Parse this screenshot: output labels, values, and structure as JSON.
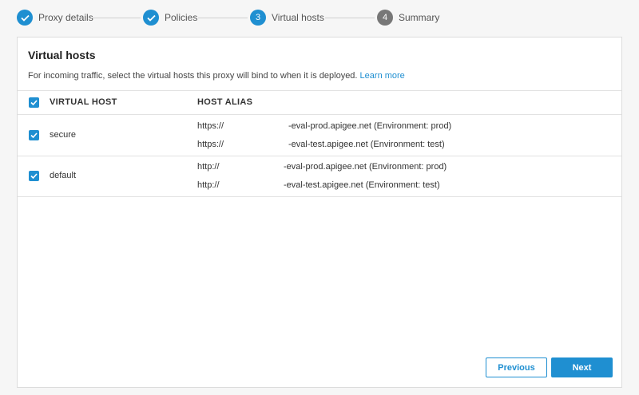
{
  "stepper": {
    "steps": [
      {
        "number": "",
        "label": "Proxy details",
        "state": "done"
      },
      {
        "number": "",
        "label": "Policies",
        "state": "done"
      },
      {
        "number": "3",
        "label": "Virtual hosts",
        "state": "active"
      },
      {
        "number": "4",
        "label": "Summary",
        "state": "pending"
      }
    ]
  },
  "card": {
    "title": "Virtual hosts",
    "description": "For incoming traffic, select the virtual hosts this proxy will bind to when it is deployed.",
    "learn_more": "Learn more"
  },
  "table": {
    "col_virtual_host": "VIRTUAL HOST",
    "col_host_alias": "HOST ALIAS",
    "rows": [
      {
        "name": "secure",
        "checked": true,
        "aliases": [
          {
            "protocol": "https://",
            "host": "-eval-prod.apigee.net (Environment: prod)"
          },
          {
            "protocol": "https://",
            "host": "-eval-test.apigee.net (Environment: test)"
          }
        ]
      },
      {
        "name": "default",
        "checked": true,
        "aliases": [
          {
            "protocol": "http://",
            "host": "-eval-prod.apigee.net (Environment: prod)"
          },
          {
            "protocol": "http://",
            "host": "-eval-test.apigee.net (Environment: test)"
          }
        ]
      }
    ]
  },
  "buttons": {
    "previous": "Previous",
    "next": "Next"
  },
  "colors": {
    "accent": "#1f8fd1",
    "pending": "#777777"
  }
}
